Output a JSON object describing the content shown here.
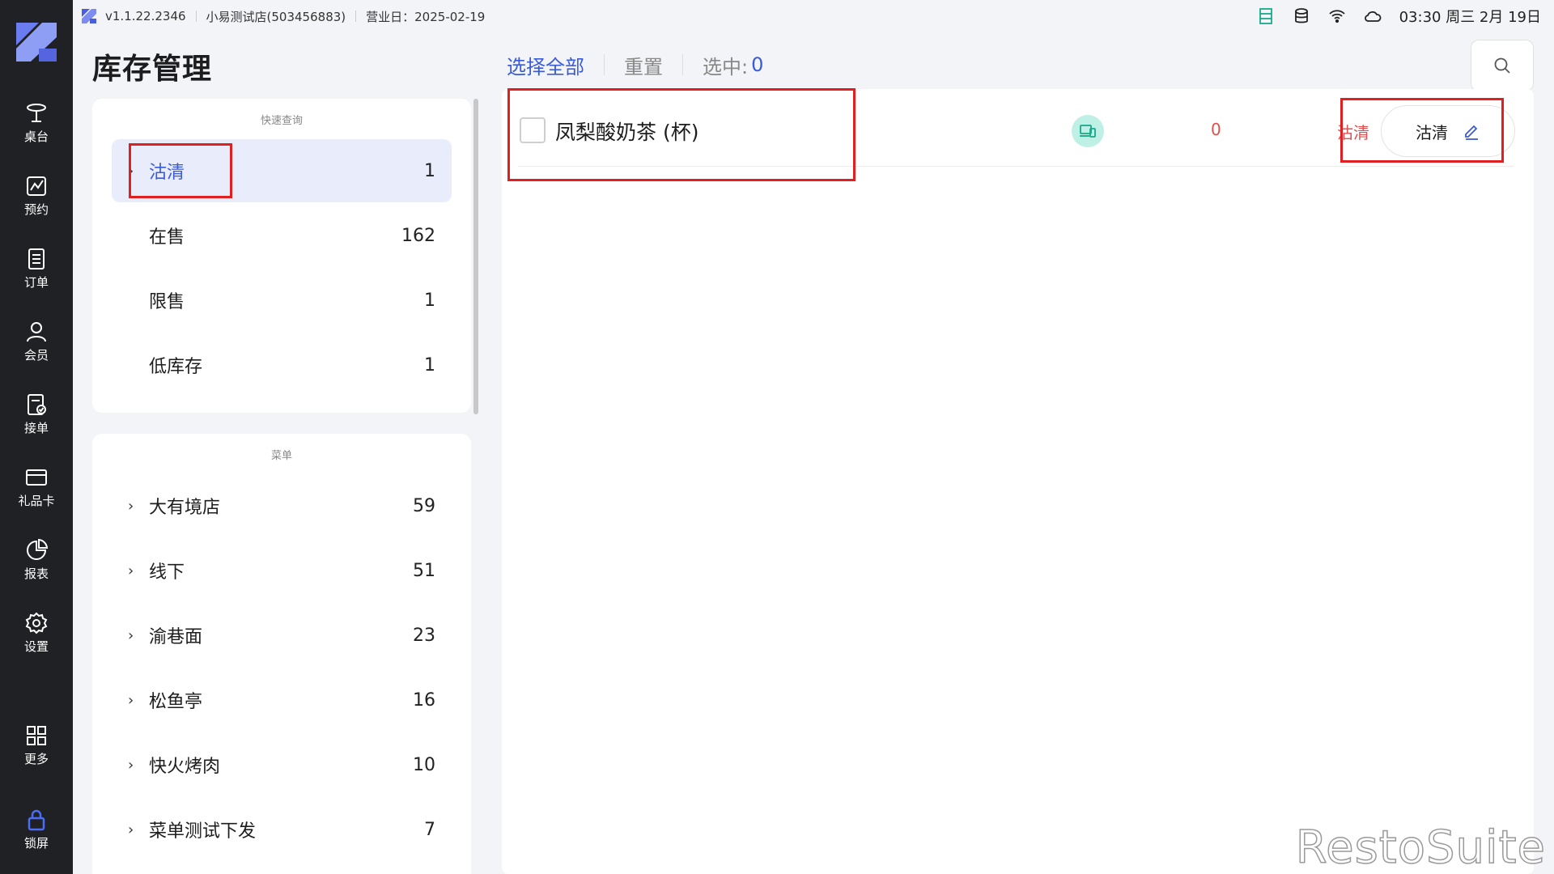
{
  "app": {
    "version": "v1.1.22.2346",
    "store": "小易测试店(503456883)",
    "business_day": "营业日：2025-02-19",
    "clock": "03:30 周三 2月 19日"
  },
  "nav": {
    "items": [
      {
        "label": "桌台",
        "icon": "table-icon"
      },
      {
        "label": "预约",
        "icon": "reservation-icon"
      },
      {
        "label": "订单",
        "icon": "order-icon"
      },
      {
        "label": "会员",
        "icon": "member-icon"
      },
      {
        "label": "接单",
        "icon": "accept-order-icon"
      },
      {
        "label": "礼品卡",
        "icon": "gift-card-icon"
      },
      {
        "label": "报表",
        "icon": "report-icon"
      },
      {
        "label": "设置",
        "icon": "settings-icon"
      },
      {
        "label": "更多",
        "icon": "more-icon"
      },
      {
        "label": "锁屏",
        "icon": "lock-icon"
      }
    ]
  },
  "page": {
    "title": "库存管理"
  },
  "quick_query": {
    "heading": "快速查询",
    "items": [
      {
        "label": "沽清",
        "count": "1",
        "active": true
      },
      {
        "label": "在售",
        "count": "162"
      },
      {
        "label": "限售",
        "count": "1"
      },
      {
        "label": "低库存",
        "count": "1"
      }
    ]
  },
  "menu": {
    "heading": "菜单",
    "items": [
      {
        "label": "大有境店",
        "count": "59"
      },
      {
        "label": "线下",
        "count": "51"
      },
      {
        "label": "渝巷面",
        "count": "23"
      },
      {
        "label": "松鱼亭",
        "count": "16"
      },
      {
        "label": "快火烤肉",
        "count": "10"
      },
      {
        "label": "菜单测试下发",
        "count": "7"
      }
    ]
  },
  "toolbar": {
    "select_all": "选择全部",
    "reset": "重置",
    "selected_label": "选中:",
    "selected_count": "0"
  },
  "items": [
    {
      "name": "凤梨酸奶茶 (杯)",
      "qty": "0",
      "status": "沽清",
      "status_button": "沽清"
    }
  ],
  "watermark": "RestoSuite",
  "colors": {
    "accent": "#3a5bd9",
    "nav_bg": "#1f2124",
    "alert": "#e05050",
    "highlight": "#e02020"
  }
}
